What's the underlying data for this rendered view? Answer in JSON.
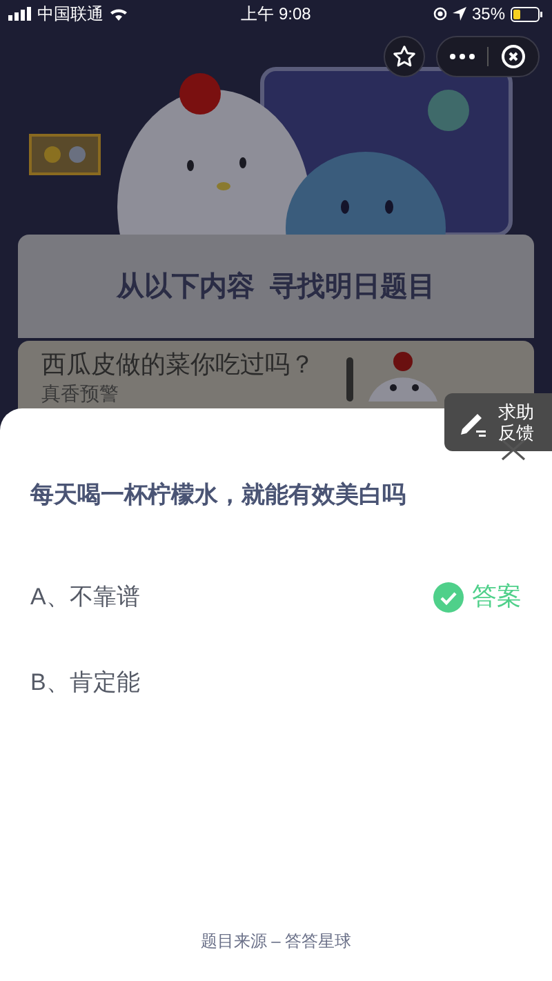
{
  "status_bar": {
    "carrier": "中国联通",
    "time": "上午 9:08",
    "battery": "35%"
  },
  "banner": {
    "title": "从以下内容  寻找明日题目"
  },
  "article": {
    "title": "西瓜皮做的菜你吃过吗？",
    "tag": "真香预警"
  },
  "feedback": {
    "label": "求助反馈"
  },
  "question": {
    "text": "每天喝一杯柠檬水，就能有效美白吗",
    "options": [
      {
        "label": "A、不靠谱",
        "correct": true
      },
      {
        "label": "B、肯定能",
        "correct": false
      }
    ],
    "answer_label": "答案"
  },
  "footer": "题目来源 – 答答星球"
}
